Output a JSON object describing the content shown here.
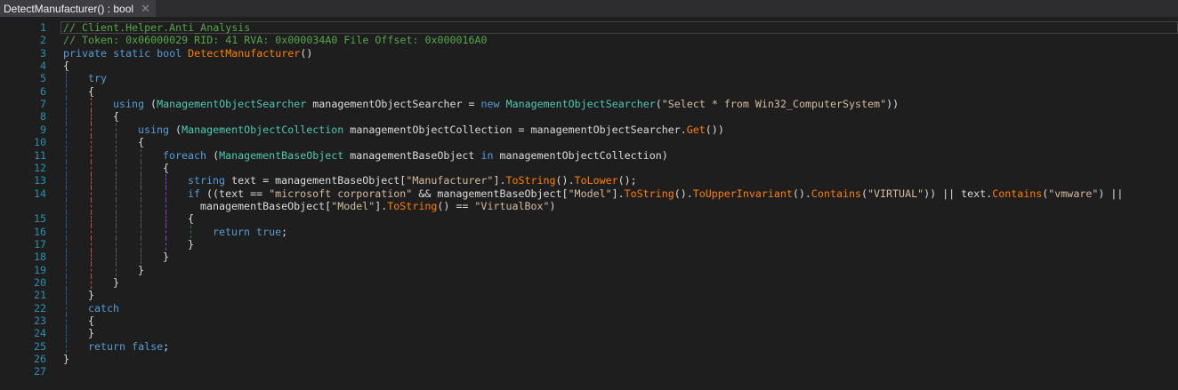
{
  "tab": {
    "title": "DetectManufacturer() : bool",
    "close_icon": "close-icon"
  },
  "colors": {
    "keyword": "#569cd6",
    "type": "#4ec9b0",
    "method": "#ff8000",
    "string": "#d6bba0",
    "comment": "#57a64a",
    "line_number": "#2b91af"
  },
  "guide_colors": [
    "#1f5f93",
    "#c8504a",
    "#5a5a5a",
    "#5a5a5a",
    "#8a3fc8",
    "#2e8b3a"
  ],
  "lines": [
    {
      "n": "1",
      "sp": 0,
      "tokens": [
        [
          "c",
          "// Client.Helper.Anti_Analysis"
        ]
      ]
    },
    {
      "n": "2",
      "sp": 0,
      "tokens": [
        [
          "c",
          "// Token: 0x06000029 RID: 41 RVA: 0x000034A0 File Offset: 0x000016A0"
        ]
      ]
    },
    {
      "n": "3",
      "sp": 0,
      "tokens": [
        [
          "k",
          "private static bool "
        ],
        [
          "m",
          "DetectManufacturer"
        ],
        [
          "p",
          "()"
        ]
      ]
    },
    {
      "n": "4",
      "sp": 0,
      "tokens": [
        [
          "p",
          "{"
        ]
      ]
    },
    {
      "n": "5",
      "sp": 4,
      "tokens": [
        [
          "k",
          "try"
        ]
      ]
    },
    {
      "n": "6",
      "sp": 4,
      "tokens": [
        [
          "p",
          "{"
        ]
      ]
    },
    {
      "n": "7",
      "sp": 8,
      "tokens": [
        [
          "k",
          "using"
        ],
        [
          "p",
          " ("
        ],
        [
          "t",
          "ManagementObjectSearcher"
        ],
        [
          "p",
          " managementObjectSearcher = "
        ],
        [
          "k",
          "new "
        ],
        [
          "t",
          "ManagementObjectSearcher"
        ],
        [
          "p",
          "("
        ],
        [
          "s",
          "\"Select * from Win32_ComputerSystem\""
        ],
        [
          "p",
          "))"
        ]
      ]
    },
    {
      "n": "8",
      "sp": 8,
      "tokens": [
        [
          "p",
          "{"
        ]
      ]
    },
    {
      "n": "9",
      "sp": 12,
      "tokens": [
        [
          "k",
          "using"
        ],
        [
          "p",
          " ("
        ],
        [
          "t",
          "ManagementObjectCollection"
        ],
        [
          "p",
          " managementObjectCollection = managementObjectSearcher."
        ],
        [
          "m",
          "Get"
        ],
        [
          "p",
          "())"
        ]
      ]
    },
    {
      "n": "10",
      "sp": 12,
      "tokens": [
        [
          "p",
          "{"
        ]
      ]
    },
    {
      "n": "11",
      "sp": 16,
      "tokens": [
        [
          "k",
          "foreach"
        ],
        [
          "p",
          " ("
        ],
        [
          "t",
          "ManagementBaseObject"
        ],
        [
          "p",
          " managementBaseObject "
        ],
        [
          "k",
          "in"
        ],
        [
          "p",
          " managementObjectCollection)"
        ]
      ]
    },
    {
      "n": "12",
      "sp": 16,
      "tokens": [
        [
          "p",
          "{"
        ]
      ]
    },
    {
      "n": "13",
      "sp": 20,
      "tokens": [
        [
          "k",
          "string"
        ],
        [
          "p",
          " text = managementBaseObject["
        ],
        [
          "s",
          "\"Manufacturer\""
        ],
        [
          "p",
          "]."
        ],
        [
          "m",
          "ToString"
        ],
        [
          "p",
          "()."
        ],
        [
          "m",
          "ToLower"
        ],
        [
          "p",
          "();"
        ]
      ]
    },
    {
      "n": "14",
      "sp": 20,
      "tokens": [
        [
          "k",
          "if"
        ],
        [
          "p",
          " ((text == "
        ],
        [
          "s",
          "\"microsoft corporation\""
        ],
        [
          "p",
          " && managementBaseObject["
        ],
        [
          "s",
          "\"Model\""
        ],
        [
          "p",
          "]."
        ],
        [
          "m",
          "ToString"
        ],
        [
          "p",
          "()."
        ],
        [
          "m",
          "ToUpperInvariant"
        ],
        [
          "p",
          "()."
        ],
        [
          "m",
          "Contains"
        ],
        [
          "p",
          "("
        ],
        [
          "s",
          "\"VIRTUAL\""
        ],
        [
          "p",
          ")) || text."
        ],
        [
          "m",
          "Contains"
        ],
        [
          "p",
          "("
        ],
        [
          "s",
          "\"vmware\""
        ],
        [
          "p",
          ") ||"
        ]
      ]
    },
    {
      "n": "",
      "sp": 22,
      "tokens": [
        [
          "p",
          "managementBaseObject["
        ],
        [
          "s",
          "\"Model\""
        ],
        [
          "p",
          "]."
        ],
        [
          "m",
          "ToString"
        ],
        [
          "p",
          "() == "
        ],
        [
          "s",
          "\"VirtualBox\""
        ],
        [
          "p",
          ")"
        ]
      ]
    },
    {
      "n": "15",
      "sp": 20,
      "tokens": [
        [
          "p",
          "{"
        ]
      ]
    },
    {
      "n": "16",
      "sp": 24,
      "tokens": [
        [
          "k",
          "return true"
        ],
        [
          "p",
          ";"
        ]
      ]
    },
    {
      "n": "17",
      "sp": 20,
      "tokens": [
        [
          "p",
          "}"
        ]
      ]
    },
    {
      "n": "18",
      "sp": 16,
      "tokens": [
        [
          "p",
          "}"
        ]
      ]
    },
    {
      "n": "19",
      "sp": 12,
      "tokens": [
        [
          "p",
          "}"
        ]
      ]
    },
    {
      "n": "20",
      "sp": 8,
      "tokens": [
        [
          "p",
          "}"
        ]
      ]
    },
    {
      "n": "21",
      "sp": 4,
      "tokens": [
        [
          "p",
          "}"
        ]
      ]
    },
    {
      "n": "22",
      "sp": 4,
      "tokens": [
        [
          "k",
          "catch"
        ]
      ]
    },
    {
      "n": "23",
      "sp": 4,
      "tokens": [
        [
          "p",
          "{"
        ]
      ]
    },
    {
      "n": "24",
      "sp": 4,
      "tokens": [
        [
          "p",
          "}"
        ]
      ]
    },
    {
      "n": "25",
      "sp": 4,
      "tokens": [
        [
          "k",
          "return false"
        ],
        [
          "p",
          ";"
        ]
      ]
    },
    {
      "n": "26",
      "sp": 0,
      "tokens": [
        [
          "p",
          "}"
        ]
      ]
    },
    {
      "n": "27",
      "sp": 0,
      "tokens": []
    }
  ]
}
